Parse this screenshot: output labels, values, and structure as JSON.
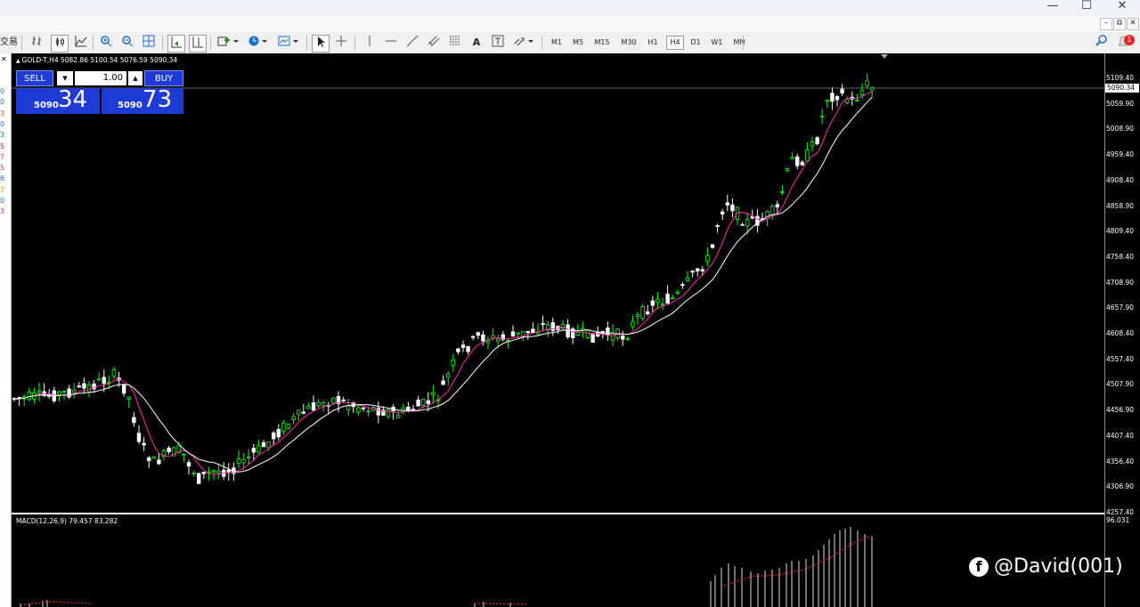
{
  "window": {
    "min": "—",
    "max": "☐",
    "close": "✕"
  },
  "menubar": {
    "left_label": "交易",
    "mdi_min": "–",
    "mdi_restore": "⧉",
    "mdi_close": "✕",
    "notif_count": "1"
  },
  "toolbar": {
    "timeframes": [
      "M1",
      "M5",
      "M15",
      "M30",
      "H1",
      "H4",
      "D1",
      "W1",
      "MN"
    ],
    "selected": "H4",
    "text_tool": "A"
  },
  "left_strip": [
    "0",
    "0",
    "3",
    "0",
    "3",
    "5",
    "7",
    "5",
    "6",
    "7",
    "0",
    "3"
  ],
  "chart": {
    "title": "GOLD-T,H4  5082.86 5100.54 5076.59 5090.34",
    "current_price": "5090.34",
    "yticks": [
      "5109.40",
      "5059.90",
      "5008.90",
      "4959.40",
      "4908.40",
      "4858.90",
      "4809.40",
      "4758.40",
      "4708.90",
      "4657.90",
      "4608.40",
      "4557.40",
      "4507.90",
      "4456.90",
      "4407.40",
      "4356.40",
      "4306.90",
      "4257.40"
    ],
    "colors": {
      "bull": "#00ff00",
      "bear": "#ffffff",
      "ma_fast": "#ff2fae",
      "ma_slow": "#ffffff"
    }
  },
  "trade": {
    "sell_label": "SELL",
    "buy_label": "BUY",
    "lot": "1.00",
    "sell_base": "5090",
    "sell_big": "34",
    "buy_base": "5090",
    "buy_big": "73"
  },
  "macd": {
    "title": "MACD(12,26,9) 79.457 83.282",
    "max": "96.031"
  },
  "watermark": "@David(001)"
}
